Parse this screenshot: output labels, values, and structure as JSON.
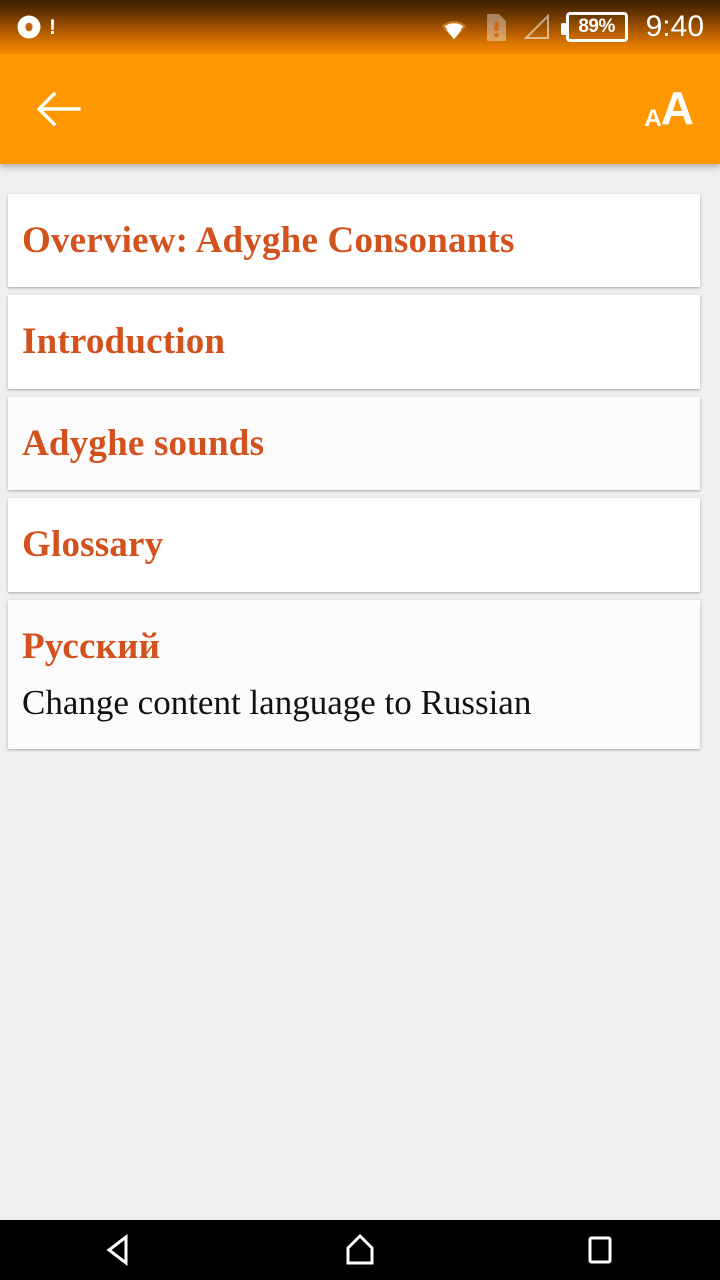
{
  "status_bar": {
    "notification_icon": "disc-alert-icon",
    "notification_badge": "!",
    "wifi_icon": "wifi-icon",
    "sim_icon": "sim-alert-icon",
    "signal_icon": "cellular-signal-icon",
    "battery_level": "89%",
    "time": "9:40"
  },
  "app_bar": {
    "back_icon": "back-arrow-icon",
    "text_size_small": "A",
    "text_size_large": "A",
    "accent_color": "#ff9800"
  },
  "content": {
    "accent_color": "#d2511c",
    "background_color": "#efefef",
    "cards": [
      {
        "title": "Overview: Adyghe Consonants",
        "subtitle": ""
      },
      {
        "title": "Introduction",
        "subtitle": ""
      },
      {
        "title": "Adyghe sounds",
        "subtitle": ""
      },
      {
        "title": "Glossary",
        "subtitle": ""
      },
      {
        "title": "Русский",
        "subtitle": "Change content language to Russian"
      }
    ]
  },
  "nav_bar": {
    "back_icon": "nav-back-triangle-icon",
    "home_icon": "nav-home-icon",
    "recents_icon": "nav-recents-square-icon"
  }
}
